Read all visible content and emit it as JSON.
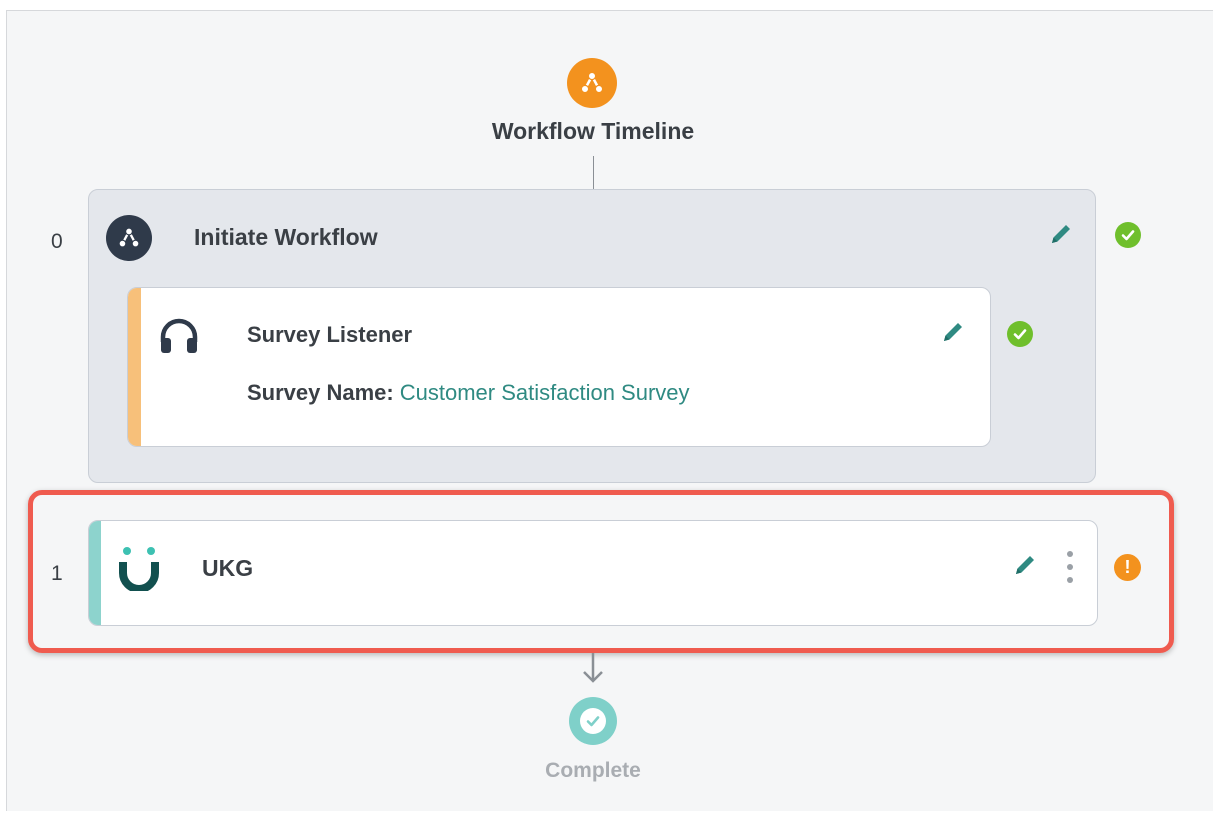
{
  "header": {
    "title": "Workflow Timeline",
    "icon": "workflow-icon",
    "icon_color": "#f3921e"
  },
  "steps": [
    {
      "number": "0",
      "title": "Initiate Workflow",
      "icon": "workflow-icon",
      "status": "complete",
      "status_color": "#6fbf2c",
      "child": {
        "title": "Survey Listener",
        "icon": "headphones-icon",
        "status": "complete",
        "field_label": "Survey Name:",
        "field_value": "Customer Satisfaction Survey",
        "accent_color": "#f7c07a"
      }
    },
    {
      "number": "1",
      "title": "UKG",
      "icon": "ukg-logo-icon",
      "status": "warning",
      "status_symbol": "!",
      "status_color": "#f3921e",
      "accent_color": "#8dd3cd"
    }
  ],
  "footer": {
    "label": "Complete",
    "icon": "check-circle-icon",
    "icon_color": "#7fd0c9"
  },
  "colors": {
    "highlight": "#ef5b4f",
    "edit_icon": "#2f8a82",
    "link_text": "#2f8a82"
  }
}
